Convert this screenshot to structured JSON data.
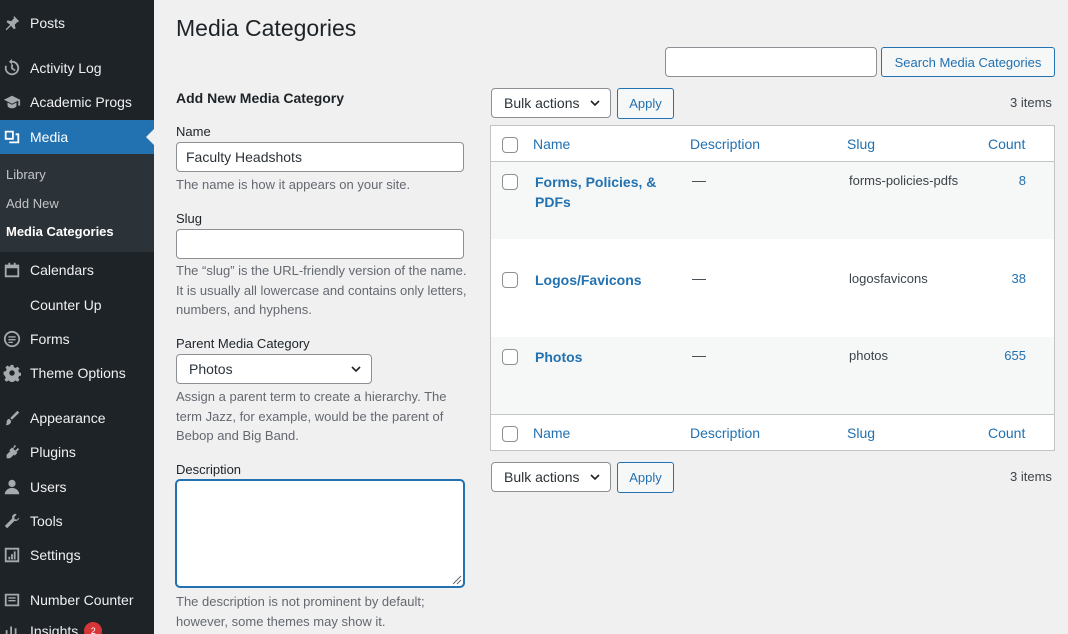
{
  "sidebar": {
    "items": [
      {
        "label": "Posts",
        "icon": "pushpin-icon"
      },
      {
        "label": "Activity Log",
        "icon": "history-icon"
      },
      {
        "label": "Academic Progs",
        "icon": "graduation-cap-icon"
      },
      {
        "label": "Media",
        "icon": "media-icon"
      },
      {
        "label": "Calendars",
        "icon": "calendar-icon"
      },
      {
        "label": "Counter Up",
        "icon": "counter-icon"
      },
      {
        "label": "Forms",
        "icon": "forms-icon"
      },
      {
        "label": "Theme Options",
        "icon": "gear-icon"
      },
      {
        "label": "Appearance",
        "icon": "paintbrush-icon"
      },
      {
        "label": "Plugins",
        "icon": "plugin-icon"
      },
      {
        "label": "Users",
        "icon": "user-icon"
      },
      {
        "label": "Tools",
        "icon": "wrench-icon"
      },
      {
        "label": "Settings",
        "icon": "settings-icon"
      },
      {
        "label": "Number Counter",
        "icon": "number-counter-icon"
      },
      {
        "label": "Insights",
        "icon": "insights-icon",
        "badge": "2"
      }
    ],
    "submenu": [
      "Library",
      "Add New",
      "Media Categories"
    ],
    "current_item": "Media",
    "current_submenu": "Media Categories"
  },
  "page": {
    "title": "Media Categories",
    "search_placeholder": "",
    "search_button": "Search Media Categories"
  },
  "form": {
    "title": "Add New Media Category",
    "name_label": "Name",
    "name_value": "Faculty Headshots",
    "name_help": "The name is how it appears on your site.",
    "slug_label": "Slug",
    "slug_value": "",
    "slug_help": "The “slug” is the URL-friendly version of the name. It is usually all lowercase and contains only letters, numbers, and hyphens.",
    "parent_label": "Parent Media Category",
    "parent_value": "Photos",
    "parent_help": "Assign a parent term to create a hierarchy. The term Jazz, for example, would be the parent of Bebop and Big Band.",
    "description_label": "Description",
    "description_value": "",
    "description_help": "The description is not prominent by default; however, some themes may show it."
  },
  "table": {
    "bulk_actions": "Bulk actions",
    "apply": "Apply",
    "items_count": "3 items",
    "columns": [
      "Name",
      "Description",
      "Slug",
      "Count"
    ],
    "rows": [
      {
        "name": "Forms, Policies, & PDFs",
        "description": "—",
        "slug": "forms-policies-pdfs",
        "count": "8"
      },
      {
        "name": "Logos/Favicons",
        "description": "—",
        "slug": "logosfavicons",
        "count": "38"
      },
      {
        "name": "Photos",
        "description": "—",
        "slug": "photos",
        "count": "655"
      }
    ]
  },
  "colors": {
    "sidebar_bg": "#1d2327",
    "accent": "#2271b1",
    "page_bg": "#f0f0f1"
  }
}
